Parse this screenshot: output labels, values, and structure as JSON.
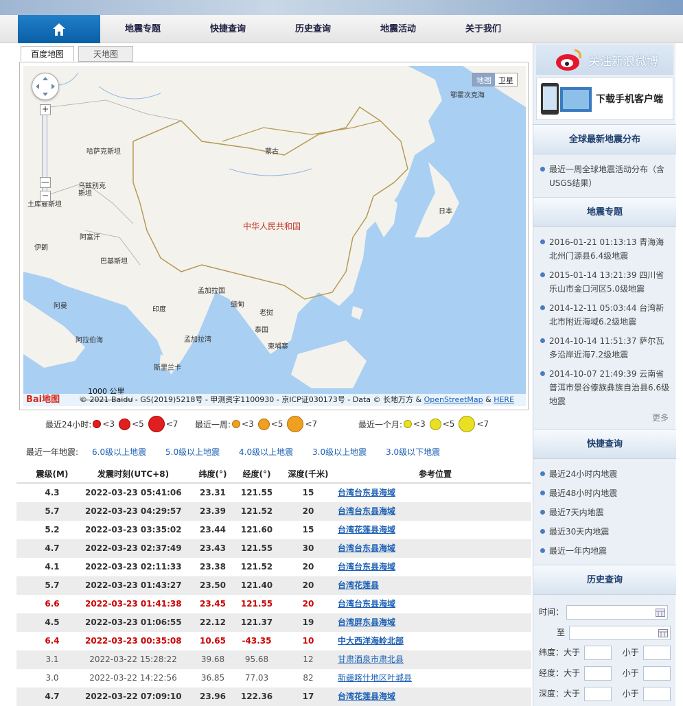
{
  "nav": {
    "items": [
      "地震专题",
      "快捷查询",
      "历史查询",
      "地震活动",
      "关于我们"
    ]
  },
  "map": {
    "tabs": [
      "百度地图",
      "天地图"
    ],
    "type_buttons": [
      "地图",
      "卫星"
    ],
    "labels": {
      "okhotsk": "鄂霍次克海",
      "kazakhstan": "哈萨克斯坦",
      "mongolia": "蒙古",
      "uzbekistan": "乌兹别克斯坦",
      "turkmenistan": "土库曼斯坦",
      "afghanistan": "阿富汗",
      "iran": "伊朗",
      "pakistan": "巴基斯坦",
      "china": "中华人民共和国",
      "japan": "日本",
      "bangladesh": "孟加拉国",
      "myanmar": "缅甸",
      "india": "印度",
      "laos": "老挝",
      "thailand": "泰国",
      "cambodia": "柬埔寨",
      "arabian_sea": "阿拉伯海",
      "bay_of_bengal": "孟加拉湾",
      "oman": "阿曼",
      "srilanka": "斯里兰卡"
    },
    "scale": "1000 公里",
    "copyright": "© 2021 Baidu - GS(2019)5218号 - 甲测资字1100930 - 京ICP证030173号 - Data © 长地万方 & ",
    "osm_link": "OpenStreetMap",
    "here_link": "HERE",
    "logo": "Bai地图"
  },
  "legend": {
    "day_label": "最近24小时:",
    "week_label": "最近一周:",
    "month_label": "最近一个月:",
    "lt3": "<3",
    "lt5": "<5",
    "lt7": "<7",
    "colors": {
      "day": "#e02020",
      "week": "#f0a020",
      "month": "#e8e020"
    }
  },
  "quicklinks": {
    "label": "最近一年地震:",
    "links": [
      "6.0级以上地震",
      "5.0级以上地震",
      "4.0级以上地震",
      "3.0级以上地震",
      "3.0级以下地震"
    ]
  },
  "table": {
    "headers": [
      "震级(M)",
      "发震时刻(UTC+8)",
      "纬度(°)",
      "经度(°)",
      "深度(千米)",
      "参考位置"
    ],
    "rows": [
      [
        "4.3",
        "2022-03-23 05:41:06",
        "23.31",
        "121.55",
        "15",
        "台湾台东县海域"
      ],
      [
        "5.7",
        "2022-03-23 04:29:57",
        "23.39",
        "121.52",
        "20",
        "台湾台东县海域"
      ],
      [
        "5.2",
        "2022-03-23 03:35:02",
        "23.44",
        "121.60",
        "15",
        "台湾花莲县海域"
      ],
      [
        "4.7",
        "2022-03-23 02:37:49",
        "23.43",
        "121.55",
        "30",
        "台湾台东县海域"
      ],
      [
        "4.1",
        "2022-03-23 02:11:33",
        "23.38",
        "121.52",
        "20",
        "台湾台东县海域"
      ],
      [
        "5.7",
        "2022-03-23 01:43:27",
        "23.50",
        "121.40",
        "20",
        "台湾花莲县"
      ],
      [
        "6.6",
        "2022-03-23 01:41:38",
        "23.45",
        "121.55",
        "20",
        "台湾台东县海域"
      ],
      [
        "4.5",
        "2022-03-23 01:06:55",
        "22.12",
        "121.37",
        "19",
        "台湾屏东县海域"
      ],
      [
        "6.4",
        "2022-03-23 00:35:08",
        "10.65",
        "-43.35",
        "10",
        "中大西洋海岭北部"
      ],
      [
        "3.1",
        "2022-03-22 15:28:22",
        "39.68",
        "95.68",
        "12",
        "甘肃酒泉市肃北县"
      ],
      [
        "3.0",
        "2022-03-22 14:22:56",
        "36.85",
        "77.03",
        "82",
        "新疆喀什地区叶城县"
      ],
      [
        "4.7",
        "2022-03-22 07:09:10",
        "23.96",
        "122.36",
        "17",
        "台湾花莲县海域"
      ]
    ]
  },
  "sidebar": {
    "weibo": "关注新浪微博",
    "app": "下载手机客户端",
    "global_title": "全球最新地震分布",
    "global_items": [
      "最近一周全球地震活动分布（含USGS结果）"
    ],
    "topic_title": "地震专题",
    "topic_items": [
      "2016-01-21 01:13:13 青海海北州门源县6.4级地震",
      "2015-01-14 13:21:39 四川省乐山市金口河区5.0级地震",
      "2014-12-11 05:03:44 台湾新北市附近海域6.2级地震",
      "2014-10-14 11:51:37 萨尔瓦多沿岸近海7.2级地震",
      "2014-10-07 21:49:39 云南省普洱市景谷傣族彝族自治县6.6级地震"
    ],
    "more": "更多",
    "quick_title": "快捷查询",
    "quick_items": [
      "最近24小时内地震",
      "最近48小时内地震",
      "最近7天内地震",
      "最近30天内地震",
      "最近一年内地震"
    ],
    "history_title": "历史查询",
    "form": {
      "time": "时间：",
      "to": "至",
      "lat": "纬度：大于",
      "lon": "经度：大于",
      "depth": "深度：大于",
      "less": "小于"
    }
  }
}
